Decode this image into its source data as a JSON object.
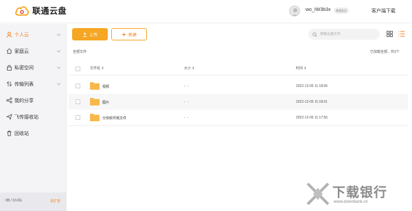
{
  "header": {
    "app_name": "联通云盘",
    "username": "wo_IW3b3x",
    "member_badge": "普通会员",
    "client_download": "客户端下载"
  },
  "sidebar": {
    "items": [
      {
        "label": "个人云",
        "icon": "person-icon",
        "active": true,
        "expandable": true
      },
      {
        "label": "家庭云",
        "icon": "home-icon",
        "active": false,
        "expandable": true
      },
      {
        "label": "私密空间",
        "icon": "lock-icon",
        "active": false,
        "expandable": true
      },
      {
        "label": "传输列表",
        "icon": "transfer-icon",
        "active": false,
        "expandable": true
      },
      {
        "label": "我的分享",
        "icon": "share-icon",
        "active": false,
        "expandable": false
      },
      {
        "label": "飞传接收站",
        "icon": "send-icon",
        "active": false,
        "expandable": false
      },
      {
        "label": "回收站",
        "icon": "trash-icon",
        "active": false,
        "expandable": false
      }
    ],
    "storage": {
      "used_text": "0B / 10.0G",
      "used_fraction": 0.0,
      "expand_label": "去扩容"
    }
  },
  "toolbar": {
    "upload_label": "上传",
    "new_label": "新建",
    "search_placeholder": "搜索云盘文件"
  },
  "breadcrumb": "全部文件",
  "loaded_status": "已加载全部，共3个",
  "table": {
    "headers": {
      "name": "文件名 ⇕",
      "size": "大小 ⇕",
      "time": "时间 ⇕"
    },
    "rows": [
      {
        "name": "视频",
        "size": "- -",
        "time": "2022-12-05 11:18:06"
      },
      {
        "name": "图片",
        "size": "- -",
        "time": "2022-12-05 11:18:01"
      },
      {
        "name": "分快软件我文件",
        "size": "- -",
        "time": "2022-12-05 11:17:56"
      }
    ]
  },
  "watermark": {
    "title": "下载银行",
    "url": "www.downbank.cn"
  },
  "colors": {
    "accent": "#f5a623",
    "accent_text": "#f5821f",
    "sidebar_bg": "#f4f4f6",
    "folder": "#f7b84b"
  }
}
